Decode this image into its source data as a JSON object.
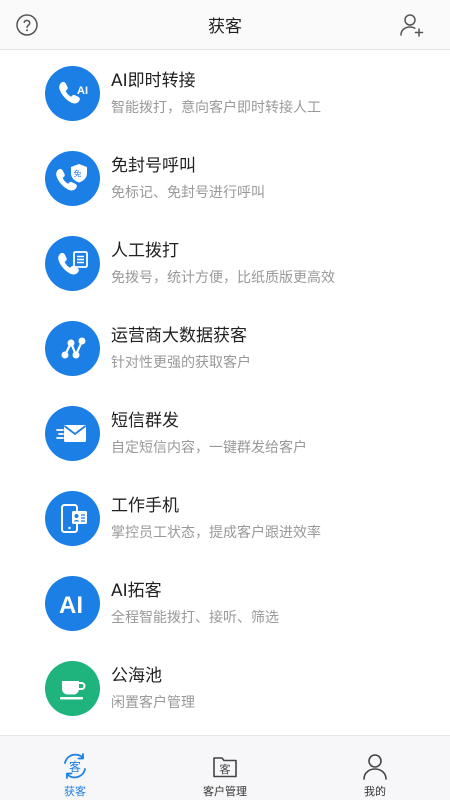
{
  "header": {
    "title": "获客",
    "help_icon": "question-circle-icon",
    "add_user_icon": "person-add-icon"
  },
  "colors": {
    "primary_blue": "#1b7fe6",
    "green": "#1fb37e",
    "title_text": "#222222",
    "desc_text": "#999999"
  },
  "items": [
    {
      "title": "AI即时转接",
      "desc": "智能拨打，意向客户即时转接人工",
      "icon": "phone-ai-icon"
    },
    {
      "title": "免封号呼叫",
      "desc": "免标记、免封号进行呼叫",
      "icon": "phone-shield-icon"
    },
    {
      "title": "人工拨打",
      "desc": "免拨号，统计方便，比纸质版更高效",
      "icon": "phone-list-icon"
    },
    {
      "title": "运营商大数据获客",
      "desc": "针对性更强的获取客户",
      "icon": "network-nodes-icon"
    },
    {
      "title": "短信群发",
      "desc": "自定短信内容，一键群发给客户",
      "icon": "envelope-send-icon"
    },
    {
      "title": "工作手机",
      "desc": "掌控员工状态，提成客户跟进效率",
      "icon": "mobile-card-icon"
    },
    {
      "title": "AI拓客",
      "desc": "全程智能拨打、接听、筛选",
      "icon": "ai-icon"
    },
    {
      "title": "公海池",
      "desc": "闲置客户管理",
      "icon": "cup-icon"
    }
  ],
  "tabs": [
    {
      "label": "获客",
      "glyph": "客",
      "active": true,
      "icon": "customer-cycle-icon"
    },
    {
      "label": "客户管理",
      "glyph": "客",
      "active": false,
      "icon": "folder-customer-icon"
    },
    {
      "label": "我的",
      "active": false,
      "icon": "user-icon"
    }
  ]
}
